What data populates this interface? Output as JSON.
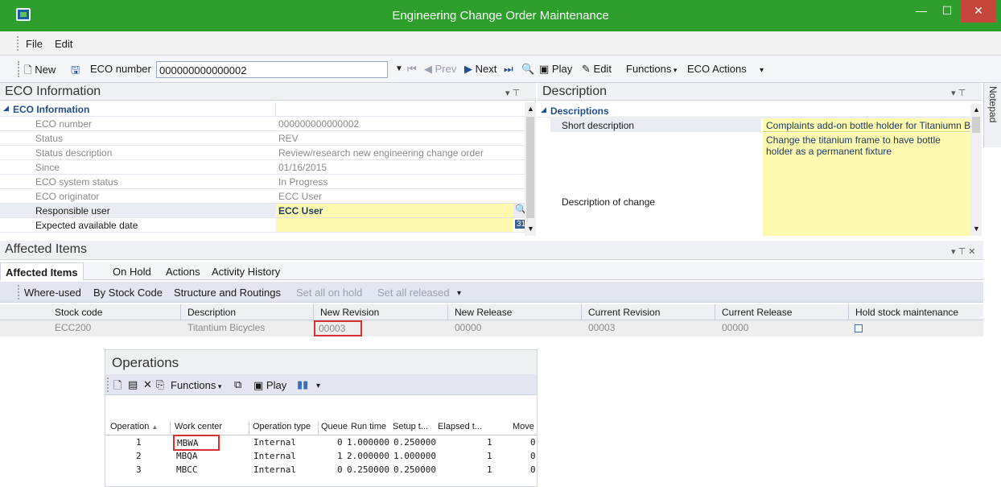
{
  "window": {
    "title": "Engineering Change Order Maintenance"
  },
  "menu": [
    "File",
    "Edit"
  ],
  "toolbar": {
    "new": "New",
    "eco_number_label": "ECO number",
    "eco_number_value": "000000000000002",
    "prev": "Prev",
    "next": "Next",
    "play": "Play",
    "edit": "Edit",
    "functions": "Functions",
    "eco_actions": "ECO Actions"
  },
  "eco_info": {
    "panel_title": "ECO Information",
    "section": "ECO Information",
    "rows": [
      {
        "label": "ECO number",
        "value": "000000000000002"
      },
      {
        "label": "Status",
        "value": "REV"
      },
      {
        "label": "Status description",
        "value": "Review/research new engineering change order"
      },
      {
        "label": "Since",
        "value": "01/16/2015"
      },
      {
        "label": "ECO system status",
        "value": "In Progress"
      },
      {
        "label": "ECO originator",
        "value": "ECC User"
      },
      {
        "label": "Responsible user",
        "value": "ECC User"
      },
      {
        "label": "Expected available date",
        "value": ""
      }
    ]
  },
  "description": {
    "panel_title": "Description",
    "section": "Descriptions",
    "short_label": "Short description",
    "short_value": "Complaints add-on bottle holder for Titaniumn B",
    "change_label": "Description of change",
    "change_value": "Change the titanium frame to have bottle holder as a permanent fixture"
  },
  "notepad_label": "Notepad",
  "affected": {
    "panel_title": "Affected Items",
    "tabs": [
      "Affected Items",
      "On Hold",
      "Actions",
      "Activity History"
    ],
    "toolbar": [
      "Where-used",
      "By Stock Code",
      "Structure and Routings",
      "Set all on hold",
      "Set all released"
    ],
    "columns": [
      "Stock code",
      "Description",
      "New Revision",
      "New Release",
      "Current Revision",
      "Current Release",
      "Hold stock maintenance"
    ],
    "row": {
      "stock_code": "ECC200",
      "description": "Titantium Bicycles",
      "new_revision": "00003",
      "new_release": "00000",
      "current_revision": "00003",
      "current_release": "00000"
    }
  },
  "operations": {
    "title": "Operations",
    "functions": "Functions",
    "play": "Play",
    "columns": [
      "Operation",
      "Work center",
      "Operation type",
      "Queue",
      "Run time",
      "Setup t...",
      "Elapsed t...",
      "Move"
    ],
    "rows": [
      {
        "op": "1",
        "wc": "MBWA",
        "type": "Internal",
        "queue": "0",
        "run": "1.000000",
        "setup": "0.250000",
        "elapsed": "1",
        "move": "0"
      },
      {
        "op": "2",
        "wc": "MBQA",
        "type": "Internal",
        "queue": "1",
        "run": "2.000000",
        "setup": "1.000000",
        "elapsed": "1",
        "move": "0"
      },
      {
        "op": "3",
        "wc": "MBCC",
        "type": "Internal",
        "queue": "0",
        "run": "0.250000",
        "setup": "0.250000",
        "elapsed": "1",
        "move": "0"
      }
    ]
  },
  "colors": {
    "title_bar": "#2e9e2c",
    "close": "#c7463c",
    "highlight": "#fdfaaf",
    "annotation": "#d63030"
  }
}
